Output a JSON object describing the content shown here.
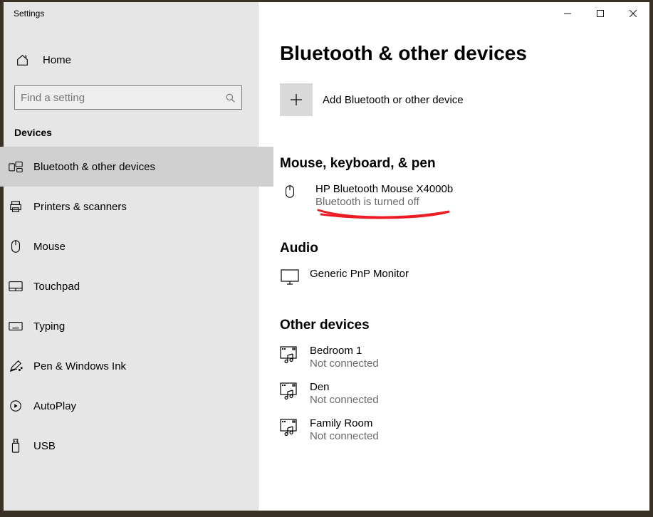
{
  "app_title": "Settings",
  "home_label": "Home",
  "search_placeholder": "Find a setting",
  "category": "Devices",
  "nav": [
    {
      "label": "Bluetooth & other devices",
      "active": true,
      "icon": "bluetooth-devices-icon"
    },
    {
      "label": "Printers & scanners",
      "active": false,
      "icon": "printer-icon"
    },
    {
      "label": "Mouse",
      "active": false,
      "icon": "mouse-icon"
    },
    {
      "label": "Touchpad",
      "active": false,
      "icon": "touchpad-icon"
    },
    {
      "label": "Typing",
      "active": false,
      "icon": "keyboard-icon"
    },
    {
      "label": "Pen & Windows Ink",
      "active": false,
      "icon": "pen-icon"
    },
    {
      "label": "AutoPlay",
      "active": false,
      "icon": "autoplay-icon"
    },
    {
      "label": "USB",
      "active": false,
      "icon": "usb-icon"
    }
  ],
  "page_title": "Bluetooth & other devices",
  "add_label": "Add Bluetooth or other device",
  "sections": [
    {
      "title": "Mouse, keyboard, & pen",
      "devices": [
        {
          "name": "HP Bluetooth Mouse X4000b",
          "status": "Bluetooth is turned off",
          "icon": "mouse-icon",
          "annot": true
        }
      ]
    },
    {
      "title": "Audio",
      "devices": [
        {
          "name": "Generic PnP Monitor",
          "status": "",
          "icon": "monitor-icon"
        }
      ]
    },
    {
      "title": "Other devices",
      "devices": [
        {
          "name": "Bedroom 1",
          "status": "Not connected",
          "icon": "media-device-icon"
        },
        {
          "name": "Den",
          "status": "Not connected",
          "icon": "media-device-icon"
        },
        {
          "name": "Family Room",
          "status": "Not connected",
          "icon": "media-device-icon"
        }
      ]
    }
  ]
}
